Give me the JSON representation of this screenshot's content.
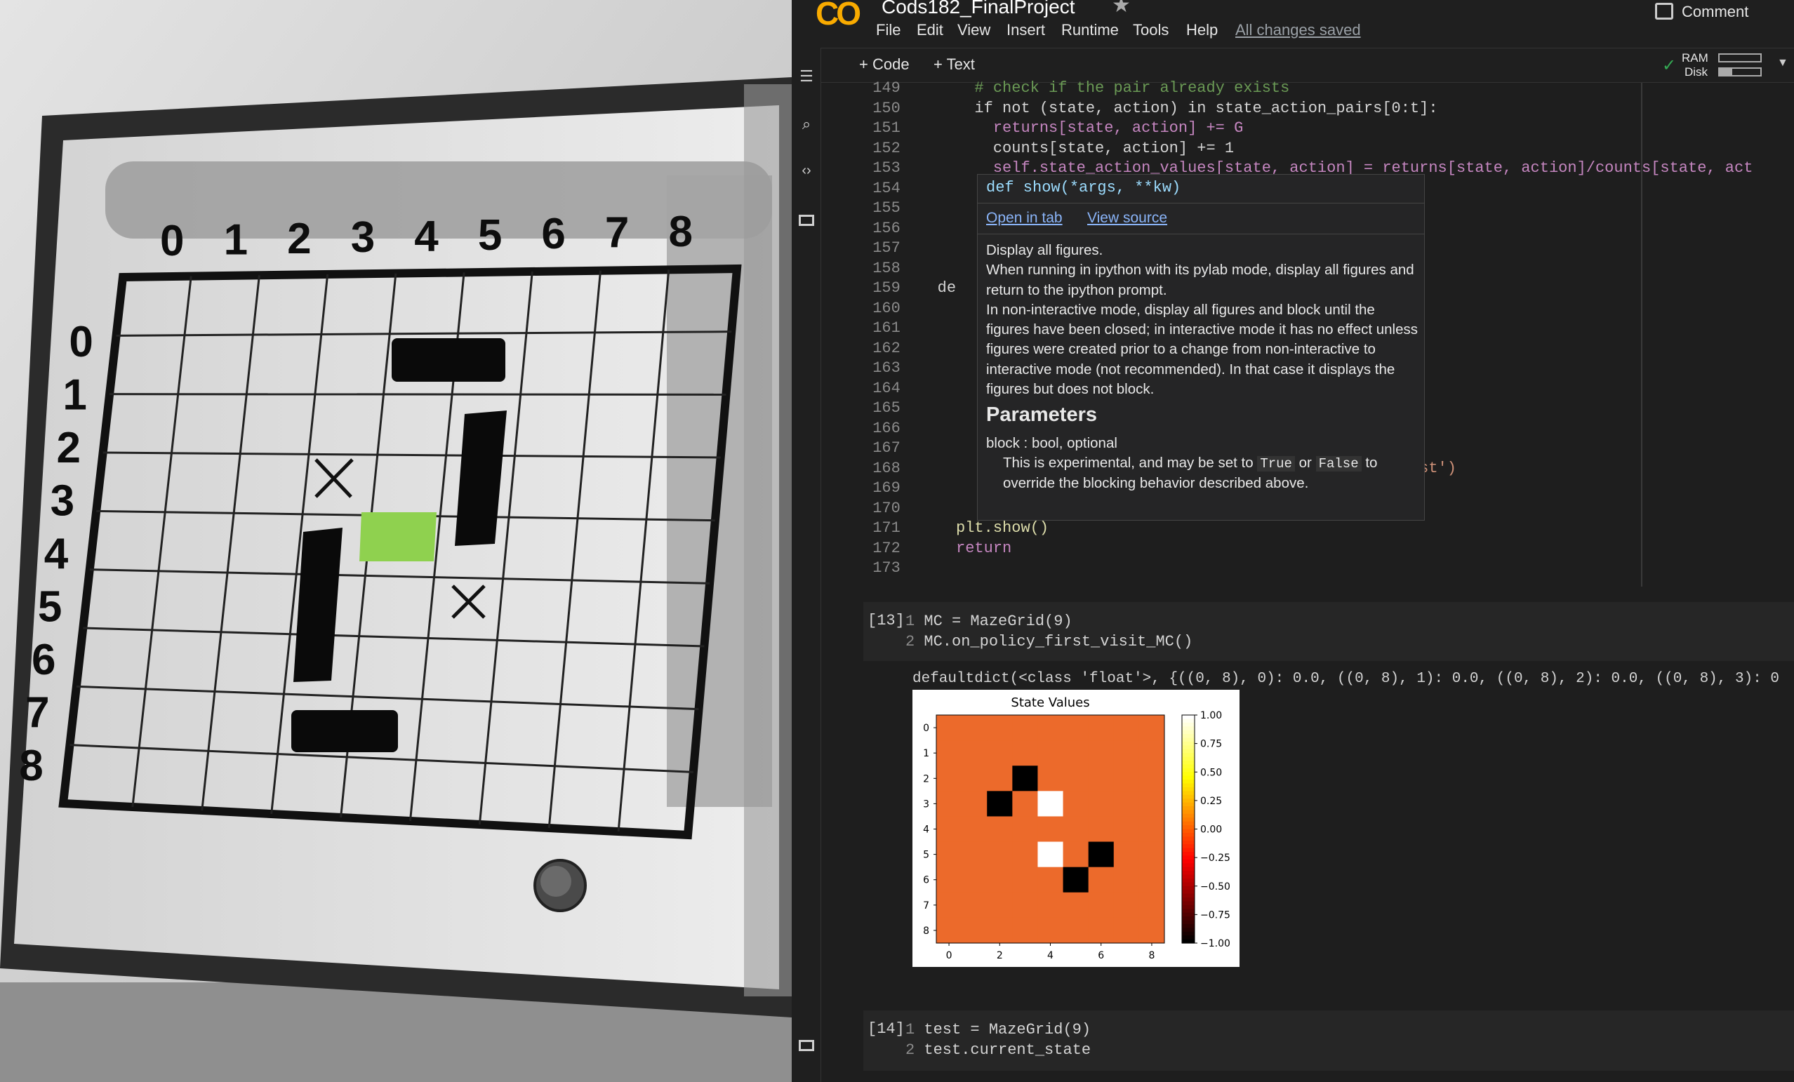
{
  "photo": {
    "col_labels": [
      "0",
      "1",
      "2",
      "3",
      "4",
      "5",
      "6",
      "7",
      "8"
    ],
    "row_labels": [
      "0",
      "1",
      "2",
      "3",
      "4",
      "5",
      "6",
      "7",
      "8"
    ],
    "marks": [
      "X",
      "X"
    ]
  },
  "colab": {
    "logo": "CO",
    "notebook_title": "Cods182_FinalProject",
    "menu": [
      "File",
      "Edit",
      "View",
      "Insert",
      "Runtime",
      "Tools",
      "Help"
    ],
    "save_status": "All changes saved",
    "comment_label": "Comment",
    "add_code": "+ Code",
    "add_text": "+ Text",
    "ram_label": "RAM",
    "disk_label": "Disk",
    "code_lines": [
      {
        "n": "149",
        "t": "      # check if the pair already exists"
      },
      {
        "n": "150",
        "t": "      if not (state, action) in state_action_pairs[0:t]:"
      },
      {
        "n": "151",
        "t": "        returns[state, action] += G"
      },
      {
        "n": "152",
        "t": "        counts[state, action] += 1"
      },
      {
        "n": "153",
        "t": "        self.state_action_values[state, action] = returns[state, action]/counts[state, act"
      },
      {
        "n": "154",
        "t": ""
      },
      {
        "n": "155",
        "t": ""
      },
      {
        "n": "156",
        "t": ""
      },
      {
        "n": "157",
        "t": ""
      },
      {
        "n": "158",
        "t": ""
      },
      {
        "n": "159",
        "t": "  de"
      },
      {
        "n": "160",
        "t": ""
      },
      {
        "n": "161",
        "t": ""
      },
      {
        "n": "162",
        "t": ""
      },
      {
        "n": "163",
        "t": ""
      },
      {
        "n": "164",
        "t": ""
      },
      {
        "n": "165",
        "t": ""
      },
      {
        "n": "166",
        "t": "                                                 ]):"
      },
      {
        "n": "167",
        "t": ""
      },
      {
        "n": "168",
        "t": "                                                 nearest')"
      },
      {
        "n": "169",
        "t": ""
      },
      {
        "n": "170",
        "t": ""
      },
      {
        "n": "171",
        "t": "    plt.show()"
      },
      {
        "n": "172",
        "t": "    return"
      },
      {
        "n": "173",
        "t": ""
      }
    ],
    "tooltip": {
      "signature": "def show(*args, **kw)",
      "open_in_tab": "Open in tab",
      "view_source": "View source",
      "desc1": "Display all figures.",
      "desc2": "When running in ipython with its pylab mode, display all figures and return to the ipython prompt.",
      "desc3": "In non-interactive mode, display all figures and block until the figures have been closed; in interactive mode it has no effect unless figures were created prior to a change from non-interactive to interactive mode (not recommended).  In that case it displays the figures but does not block.",
      "params_heading": "Parameters",
      "param_name": "block : bool, optional",
      "param_desc_a": "This is experimental, and may be set to",
      "true_word": "True",
      "or_word": "or",
      "false_word": "False",
      "to_word": "to",
      "param_desc_b": "override the blocking behavior described above."
    },
    "cell13": {
      "prompt": "[13]",
      "l1n": "1",
      "l1": "MC = MazeGrid(9)",
      "l2n": "2",
      "l2": "MC.on_policy_first_visit_MC()"
    },
    "output13": "defaultdict(<class 'float'>, {((0, 8), 0): 0.0, ((0, 8), 1): 0.0, ((0, 8), 2): 0.0, ((0, 8), 3): 0",
    "cell14": {
      "prompt": "[14]",
      "l1n": "1",
      "l1": "test = MazeGrid(9)",
      "l2n": "2",
      "l2": "test.current_state"
    }
  },
  "chart_data": {
    "type": "heatmap",
    "title": "State Values",
    "rows": 9,
    "cols": 9,
    "xticks": [
      "0",
      "2",
      "4",
      "6",
      "8"
    ],
    "yticks": [
      "0",
      "1",
      "2",
      "3",
      "4",
      "5",
      "6",
      "7",
      "8"
    ],
    "colorbar_ticks": [
      "1.00",
      "0.75",
      "0.50",
      "0.25",
      "0.00",
      "−0.25",
      "−0.50",
      "−0.75",
      "−1.00"
    ],
    "vmin": -1,
    "vmax": 1,
    "colormap": "hot",
    "default_value": 0.0,
    "cells": [
      {
        "r": 2,
        "c": 3,
        "v": -1
      },
      {
        "r": 3,
        "c": 2,
        "v": -1
      },
      {
        "r": 3,
        "c": 4,
        "v": 1
      },
      {
        "r": 5,
        "c": 4,
        "v": 1
      },
      {
        "r": 5,
        "c": 6,
        "v": -1
      },
      {
        "r": 6,
        "c": 5,
        "v": -1
      }
    ]
  }
}
